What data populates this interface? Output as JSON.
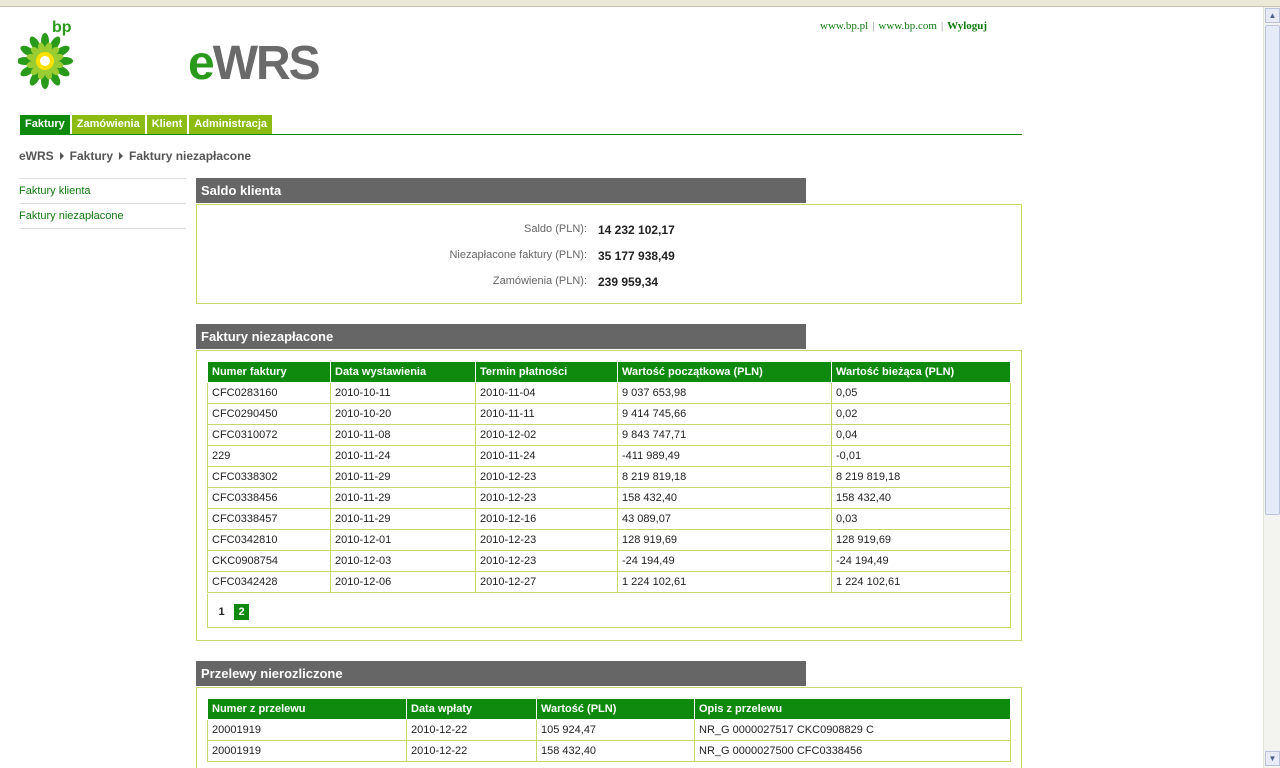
{
  "brand": {
    "logo_text": "bp",
    "app_name_e": "e",
    "app_name_rest": "WRS",
    "accent": "#0f8a0f",
    "tab_color": "#8cbb12"
  },
  "top_links": {
    "link1": "www.bp.pl",
    "sep1": "|",
    "link2": "www.bp.com",
    "sep2": "|",
    "logout": "Wyloguj"
  },
  "nav": {
    "tabs": [
      {
        "label": "Faktury"
      },
      {
        "label": "Zamówienia"
      },
      {
        "label": "Klient"
      },
      {
        "label": "Administracja"
      }
    ]
  },
  "breadcrumb": [
    "eWRS",
    "Faktury",
    "Faktury niezapłacone"
  ],
  "sidebar": {
    "items": [
      {
        "label": "Faktury klienta"
      },
      {
        "label": "Faktury niezapłacone"
      }
    ]
  },
  "saldo": {
    "title": "Saldo klienta",
    "rows": [
      {
        "label": "Saldo (PLN):",
        "value": "14 232 102,17"
      },
      {
        "label": "Niezapłacone faktury (PLN):",
        "value": "35 177 938,49"
      },
      {
        "label": "Zamówienia (PLN):",
        "value": "239 959,34"
      }
    ]
  },
  "invoices": {
    "title": "Faktury niezapłacone",
    "headers": [
      "Numer faktury",
      "Data wystawienia",
      "Termin płatności",
      "Wartość początkowa (PLN)",
      "Wartość bieżąca (PLN)"
    ],
    "rows": [
      [
        "CFC0283160",
        "2010-10-11",
        "2010-11-04",
        "9 037 653,98",
        "0,05"
      ],
      [
        "CFC0290450",
        "2010-10-20",
        "2010-11-11",
        "9 414 745,66",
        "0,02"
      ],
      [
        "CFC0310072",
        "2010-11-08",
        "2010-12-02",
        "9 843 747,71",
        "0,04"
      ],
      [
        "229",
        "2010-11-24",
        "2010-11-24",
        "-411 989,49",
        "-0,01"
      ],
      [
        "CFC0338302",
        "2010-11-29",
        "2010-12-23",
        "8 219 819,18",
        "8 219 819,18"
      ],
      [
        "CFC0338456",
        "2010-11-29",
        "2010-12-23",
        "158 432,40",
        "158 432,40"
      ],
      [
        "CFC0338457",
        "2010-11-29",
        "2010-12-16",
        "43 089,07",
        "0,03"
      ],
      [
        "CFC0342810",
        "2010-12-01",
        "2010-12-23",
        "128 919,69",
        "128 919,69"
      ],
      [
        "CKC0908754",
        "2010-12-03",
        "2010-12-23",
        "-24 194,49",
        "-24 194,49"
      ],
      [
        "CFC0342428",
        "2010-12-06",
        "2010-12-27",
        "1 224 102,61",
        "1 224 102,61"
      ]
    ],
    "pager": {
      "current": "1",
      "next": "2"
    }
  },
  "transfers": {
    "title": "Przelewy nierozliczone",
    "headers": [
      "Numer z przelewu",
      "Data wpłaty",
      "Wartość (PLN)",
      "Opis z przelewu"
    ],
    "rows": [
      [
        "20001919",
        "2010-12-22",
        "105 924,47",
        "NR_G 0000027517 CKC0908829 C"
      ],
      [
        "20001919",
        "2010-12-22",
        "158 432,40",
        "NR_G 0000027500 CFC0338456"
      ]
    ]
  }
}
